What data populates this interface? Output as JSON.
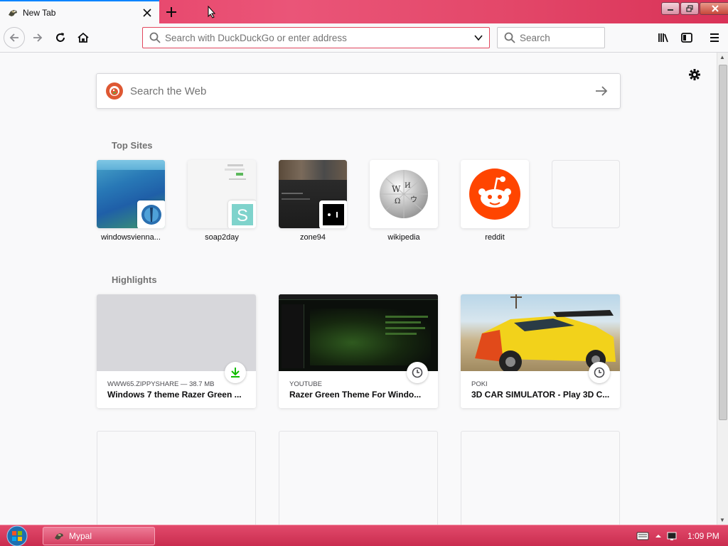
{
  "tab": {
    "title": "New Tab",
    "close_glyph": "✕",
    "favicon": "firefox-dino-icon"
  },
  "window_controls": {
    "minimize": "minimize-icon",
    "restore": "restore-icon",
    "close": "close-icon"
  },
  "nav": {
    "back": "back-arrow-icon",
    "forward": "forward-arrow-icon",
    "reload": "reload-icon",
    "home": "home-icon"
  },
  "url_bar": {
    "placeholder": "Search with DuckDuckGo or enter address",
    "value": ""
  },
  "search_bar": {
    "placeholder": "Search"
  },
  "toolbar_right": [
    "library-icon",
    "sidebar-icon",
    "menu-icon"
  ],
  "web_search": {
    "placeholder": "Search the Web",
    "engine": "duckduckgo-icon"
  },
  "top_sites": {
    "title": "Top Sites",
    "items": [
      {
        "label": "windowsvienna..."
      },
      {
        "label": "soap2day"
      },
      {
        "label": "zone94"
      },
      {
        "label": "wikipedia"
      },
      {
        "label": "reddit"
      },
      {
        "label": ""
      }
    ]
  },
  "highlights": {
    "title": "Highlights",
    "items": [
      {
        "source": "WWW65.ZIPPYSHARE — 38.7 MB",
        "title": "Windows 7 theme Razer Green ...",
        "badge": "download-icon"
      },
      {
        "source": "YOUTUBE",
        "title": "Razer Green Theme For Windo...",
        "badge": "clock-icon"
      },
      {
        "source": "POKI",
        "title": "3D CAR SIMULATOR - Play 3D C...",
        "badge": "clock-icon"
      }
    ]
  },
  "taskbar": {
    "task_label": "Mypal",
    "clock": "1:09 PM"
  },
  "colors": {
    "titlebar": "#e63b63",
    "url_border": "#e2475d",
    "accent": "#0a84ff",
    "reddit": "#ff4500",
    "ddg": "#de5833",
    "download_green": "#12bc00"
  }
}
